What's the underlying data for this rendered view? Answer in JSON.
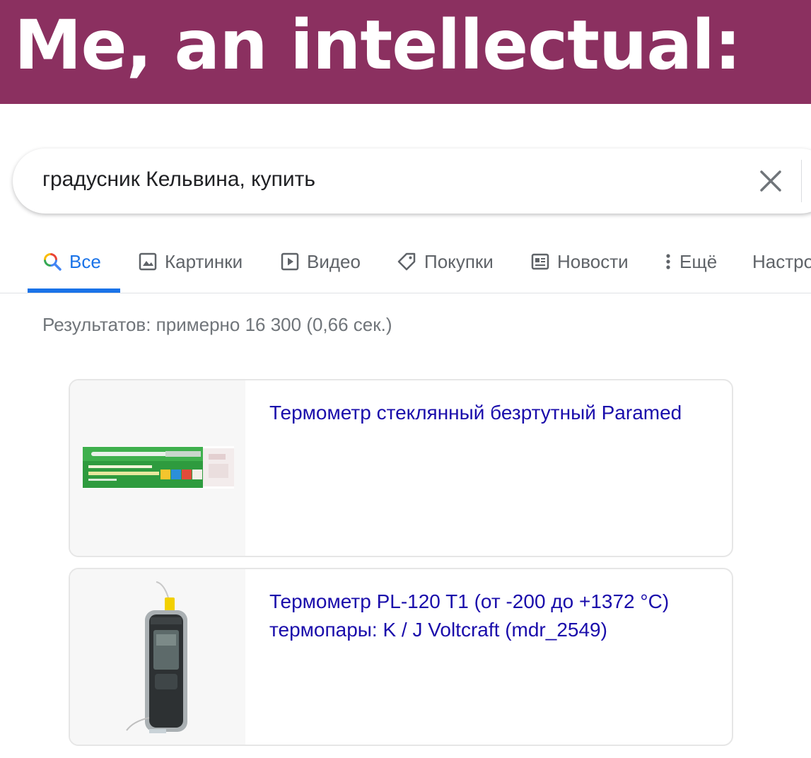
{
  "banner": {
    "text": "Me, an intellectual:",
    "background": "#8b3060"
  },
  "search": {
    "query": "градусник Кельвина, купить",
    "clear_icon": "close-icon"
  },
  "tabs": [
    {
      "label": "Все",
      "icon": "search-icon",
      "active": true
    },
    {
      "label": "Картинки",
      "icon": "image-icon",
      "active": false
    },
    {
      "label": "Видео",
      "icon": "play-icon",
      "active": false
    },
    {
      "label": "Покупки",
      "icon": "tag-icon",
      "active": false
    },
    {
      "label": "Новости",
      "icon": "newspaper-icon",
      "active": false
    },
    {
      "label": "Ещё",
      "icon": "more-vert-icon",
      "active": false
    },
    {
      "label": "Настро",
      "active": false
    }
  ],
  "results": {
    "stats": "Результатов: примерно 16 300 (0,66 сек.)",
    "items": [
      {
        "title": "Термометр стеклянный безртутный Paramed",
        "image_icon": "glass-thermometer-product-image"
      },
      {
        "title": "Термометр PL-120 T1 (от -200 до +1372 °C) термопары: K / J Voltcraft (mdr_2549)",
        "image_icon": "digital-thermometer-product-image"
      }
    ]
  },
  "colors": {
    "accent": "#1a73e8",
    "link": "#1a0dab",
    "muted": "#70757a"
  }
}
